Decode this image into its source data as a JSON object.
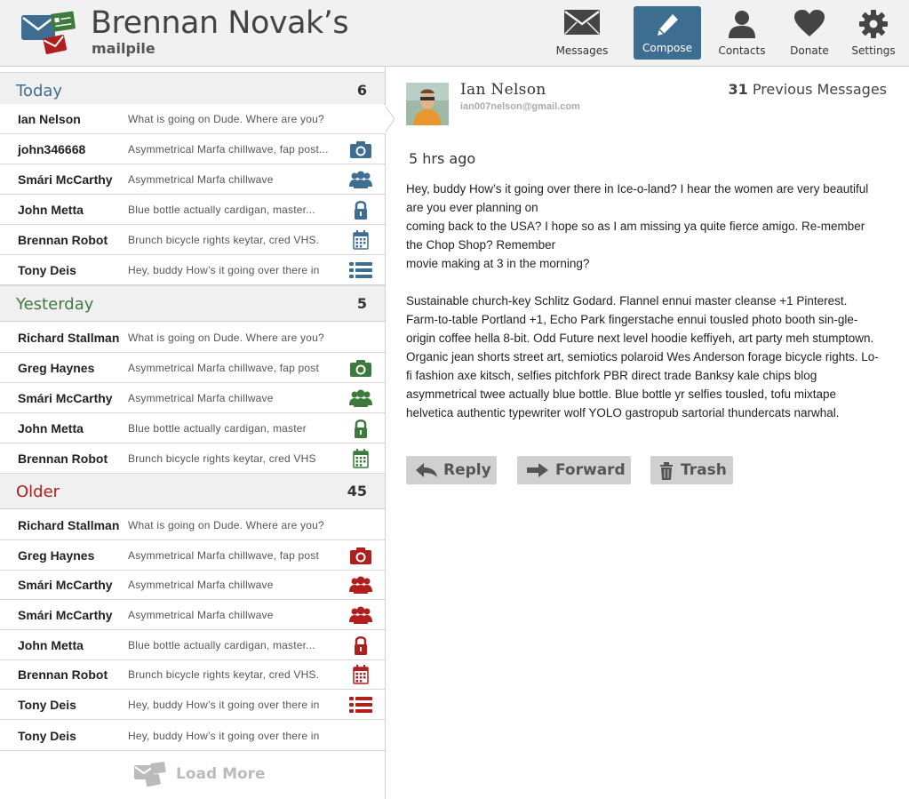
{
  "header": {
    "title": "Brennan Novak’s",
    "subtitle": "mailpile",
    "nav": [
      {
        "label": "Messages",
        "icon": "envelope-icon"
      },
      {
        "label": "Compose",
        "icon": "pencil-icon"
      },
      {
        "label": "Contacts",
        "icon": "person-icon"
      },
      {
        "label": "Donate",
        "icon": "heart-icon"
      },
      {
        "label": "Settings",
        "icon": "gear-icon"
      }
    ]
  },
  "colors": {
    "today": "#3d6e92",
    "yesterday": "#3e7a3e",
    "older": "#b01e1e",
    "compose_bg": "#3d6e92"
  },
  "groups": [
    {
      "title": "Today",
      "count": "6",
      "rows": [
        {
          "name": "Ian Nelson",
          "snippet": "What is going on Dude. Where are you?",
          "icon": ""
        },
        {
          "name": "john346668",
          "snippet": "Asymmetrical Marfa chillwave, fap post...",
          "icon": "camera-icon"
        },
        {
          "name": "Smári McCarthy",
          "snippet": "Asymmetrical Marfa chillwave",
          "icon": "group-icon"
        },
        {
          "name": "John Metta",
          "snippet": "Blue bottle actually cardigan, master...",
          "icon": "lock-icon"
        },
        {
          "name": "Brennan Robot",
          "snippet": "Brunch bicycle rights keytar, cred VHS.",
          "icon": "calendar-icon"
        },
        {
          "name": "Tony Deis",
          "snippet": "Hey, buddy  How’s it going over there in",
          "icon": "list-icon"
        }
      ]
    },
    {
      "title": "Yesterday",
      "count": "5",
      "rows": [
        {
          "name": "Richard Stallman",
          "snippet": "What is going on Dude. Where are you?",
          "icon": ""
        },
        {
          "name": "Greg Haynes",
          "snippet": "Asymmetrical Marfa chillwave, fap post",
          "icon": "camera-icon"
        },
        {
          "name": "Smári McCarthy",
          "snippet": "Asymmetrical Marfa chillwave",
          "icon": "group-icon"
        },
        {
          "name": "John Metta",
          "snippet": "Blue bottle actually cardigan, master",
          "icon": "lock-icon"
        },
        {
          "name": "Brennan Robot",
          "snippet": "Brunch bicycle rights keytar, cred VHS",
          "icon": "calendar-icon"
        }
      ]
    },
    {
      "title": "Older",
      "count": "45",
      "rows": [
        {
          "name": "Richard Stallman",
          "snippet": "What is going on Dude. Where are you?",
          "icon": ""
        },
        {
          "name": "Greg Haynes",
          "snippet": "Asymmetrical Marfa chillwave, fap post",
          "icon": "camera-icon"
        },
        {
          "name": "Smári McCarthy",
          "snippet": "Asymmetrical Marfa chillwave",
          "icon": "group-icon"
        },
        {
          "name": "Smári McCarthy",
          "snippet": "Asymmetrical Marfa chillwave",
          "icon": "group-icon"
        },
        {
          "name": "John Metta",
          "snippet": "Blue bottle actually cardigan, master...",
          "icon": "lock-icon"
        },
        {
          "name": "Brennan Robot",
          "snippet": "Brunch bicycle rights keytar, cred VHS.",
          "icon": "calendar-icon"
        },
        {
          "name": "Tony Deis",
          "snippet": "Hey, buddy  How’s it going over there in",
          "icon": "list-icon"
        },
        {
          "name": "Tony Deis",
          "snippet": "Hey, buddy  How’s it going over there in",
          "icon": ""
        }
      ]
    }
  ],
  "load_more": "Load More",
  "message": {
    "from_name": "Ian Nelson",
    "from_email": "ian007nelson@gmail.com",
    "previous_count": "31",
    "previous_label": "Previous Messages",
    "time": "5 hrs ago",
    "paragraphs": [
      "Hey, buddy  How’s it going over there in Ice-o-land? I hear the women are very beautiful are you ever planning on\ncoming back to the USA? I hope so as I am missing ya quite fierce amigo. Re-member the Chop Shop? Remember\nmovie making at 3 in the morning?",
      "Sustainable church-key Schlitz Godard. Flannel ennui master cleanse +1 Pinterest. Farm-to-table Portland +1, Echo Park fingerstache ennui tousled photo booth sin-gle-origin coffee hella 8-bit. Odd Future next level hoodie keffiyeh, art party meh stumptown. Organic jean shorts street art, semiotics polaroid Wes Anderson forage bicycle rights. Lo-fi fashion axe kitsch, selfies pitchfork PBR direct trade Banksy kale chips blog asymmetrical twee actually blue bottle. Blue bottle yr selfies tousled, tofu mixtape helvetica authentic typewriter wolf YOLO gastropub sartorial thundercats narwhal."
    ],
    "actions": [
      {
        "label": "Reply",
        "icon": "reply-icon"
      },
      {
        "label": "Forward",
        "icon": "forward-arrow-icon"
      },
      {
        "label": "Trash",
        "icon": "trash-icon"
      }
    ]
  }
}
